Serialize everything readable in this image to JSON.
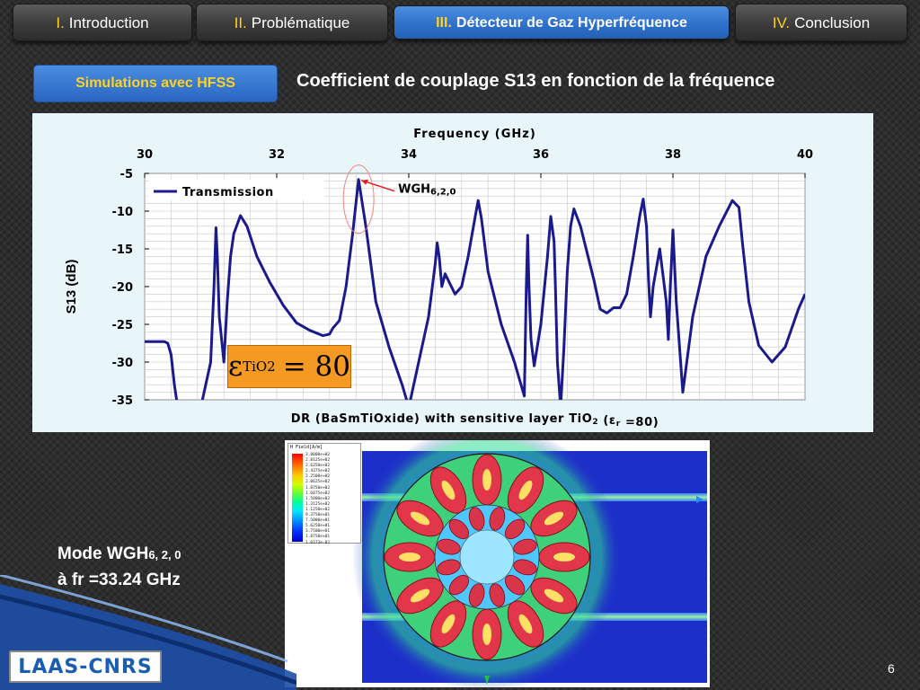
{
  "nav": {
    "tabs": [
      {
        "num": "I.",
        "label": "Introduction"
      },
      {
        "num": "II.",
        "label": "Problématique"
      },
      {
        "num": "III.",
        "label": "Détecteur de Gaz Hyperfréquence"
      },
      {
        "num": "IV.",
        "label": "Conclusion"
      }
    ],
    "active_index": 2
  },
  "section_button": "Simulations avec HFSS",
  "slide_title": "Coefficient de couplage S13 en fonction de la fréquence",
  "chart_data": {
    "type": "line",
    "xlabel": "Frequency (GHz)",
    "ylabel": "S13 (dB)",
    "xlim": [
      30,
      40
    ],
    "ylim": [
      -35,
      -5
    ],
    "xticks": [
      "30",
      "32",
      "34",
      "36",
      "38",
      "40"
    ],
    "yticks": [
      "-5",
      "-10",
      "-15",
      "-20",
      "-25",
      "-30",
      "-35"
    ],
    "grid": true,
    "x_axis_position": "top",
    "legend_position": "top-left",
    "caption": "DR (BaSmTiOxide) with sensitive layer TiO",
    "caption_sub": "2",
    "caption_tail": "(ε",
    "caption_tail_sub": "r",
    "caption_end": "=80)",
    "annotation": {
      "label": "WGH",
      "sub": "6,2,0",
      "x": 33.24,
      "y": -5.8
    },
    "colors": {
      "line": "#1a1a8c",
      "grid": "#c8c8c8",
      "annotation": "#e02020"
    },
    "series": [
      {
        "name": "Transmission",
        "x": [
          30.0,
          30.3,
          30.35,
          30.4,
          30.45,
          30.5,
          30.55,
          30.8,
          31.0,
          31.05,
          31.08,
          31.1,
          31.13,
          31.2,
          31.25,
          31.3,
          31.35,
          31.45,
          31.55,
          31.7,
          31.9,
          32.1,
          32.3,
          32.5,
          32.7,
          32.8,
          32.85,
          32.95,
          33.05,
          33.15,
          33.24,
          33.35,
          33.5,
          33.7,
          33.9,
          34.0,
          34.3,
          34.4,
          34.43,
          34.46,
          34.5,
          34.55,
          34.6,
          34.7,
          34.8,
          34.9,
          35.0,
          35.05,
          35.1,
          35.2,
          35.4,
          35.6,
          35.75,
          35.78,
          35.8,
          35.82,
          35.85,
          35.9,
          36.0,
          36.1,
          36.15,
          36.2,
          36.22,
          36.25,
          36.3,
          36.35,
          36.4,
          36.45,
          36.5,
          36.6,
          36.8,
          36.9,
          37.0,
          37.1,
          37.2,
          37.3,
          37.4,
          37.5,
          37.55,
          37.6,
          37.63,
          37.66,
          37.7,
          37.8,
          37.9,
          37.93,
          37.96,
          38.0,
          38.05,
          38.15,
          38.3,
          38.5,
          38.7,
          38.9,
          39.0,
          39.05,
          39.15,
          39.3,
          39.5,
          39.7,
          39.9,
          40.0
        ],
        "y": [
          -27.3,
          -27.3,
          -27.5,
          -29,
          -33,
          -36,
          -38,
          -38,
          -30,
          -20,
          -12.2,
          -16,
          -24,
          -30,
          -22,
          -16,
          -13,
          -10.6,
          -12,
          -16,
          -19.5,
          -22.5,
          -24.8,
          -25.8,
          -26.5,
          -26.3,
          -25.5,
          -24.5,
          -20,
          -13,
          -5.8,
          -12,
          -22,
          -28,
          -33,
          -36,
          -24,
          -17,
          -14.2,
          -16,
          -20,
          -18.3,
          -19.2,
          -21,
          -20,
          -16,
          -11,
          -8.6,
          -11,
          -18,
          -25,
          -30,
          -34.5,
          -20,
          -13.2,
          -20,
          -27,
          -30.5,
          -25,
          -16,
          -10.7,
          -14,
          -20,
          -30,
          -36,
          -28,
          -18,
          -12,
          -9.7,
          -12,
          -19,
          -23,
          -23.5,
          -22.8,
          -22.8,
          -21,
          -16,
          -10.5,
          -8.4,
          -12,
          -19,
          -24,
          -20,
          -15,
          -22,
          -27,
          -20,
          -12.5,
          -22,
          -34,
          -24,
          -16,
          -12,
          -8.6,
          -9.5,
          -14,
          -22,
          -27.8,
          -30,
          -28,
          -23,
          -21
        ]
      }
    ]
  },
  "epsilon_box": {
    "symbol": "ε",
    "sub": "TiO2",
    "value": "= 80"
  },
  "mode_label": {
    "line1": "Mode WGH",
    "line1_sub": "6, 2, 0",
    "line2": "à fr =33.24 GHz"
  },
  "field_legend": {
    "title": "H Field[A/m]",
    "values": [
      "3.0000e+02",
      "2.8125e+02",
      "2.6250e+02",
      "2.4375e+02",
      "2.2500e+02",
      "2.0625e+02",
      "1.8750e+02",
      "1.6875e+02",
      "1.5000e+02",
      "1.3125e+02",
      "1.1250e+02",
      "9.3750e+01",
      "7.5000e+01",
      "5.6250e+01",
      "3.7500e+01",
      "1.8750e+01",
      "1.0373e-02"
    ]
  },
  "logo_text": "LAAS-CNRS",
  "page_number": "6"
}
